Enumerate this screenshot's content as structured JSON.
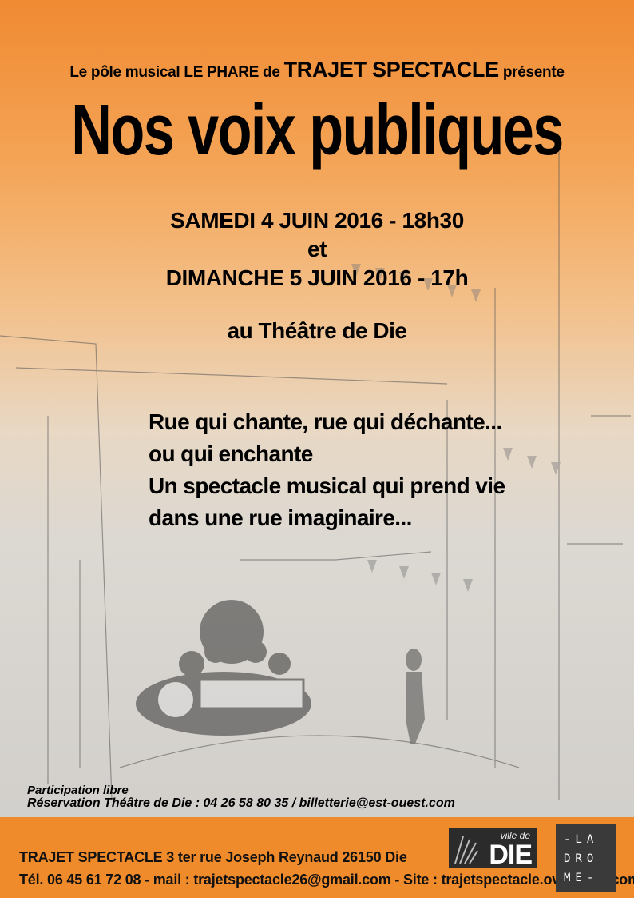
{
  "header": {
    "presents_prefix": "Le pôle musical LE PHARE de",
    "company": "TRAJET SPECTACLE",
    "presents_suffix": "présente"
  },
  "title": "Nos voix publiques",
  "dates": {
    "date1": "SAMEDI 4 JUIN 2016 - 18h30",
    "conjunction": "et",
    "date2": "DIMANCHE 5 JUIN 2016 - 17h"
  },
  "venue": "au Théâtre de Die",
  "description": [
    "Rue qui chante, rue qui déchante...",
    "ou qui enchante",
    "Un spectacle musical qui prend vie",
    "dans une rue imaginaire..."
  ],
  "info": {
    "participation": "Participation libre",
    "reservation": "Réservation Théâtre de Die : 04 26 58 80 35 / billetterie@est-ouest.com"
  },
  "footer": {
    "company_name": "TRAJET SPECTACLE",
    "address": "3 ter rue Joseph Reynaud 26150 Die",
    "contact": "Tél. 06 45 61 72 08 - mail : trajetspectacle26@gmail.com - Site : trajetspectacle.over-blog.com"
  },
  "logos": {
    "ville_de_die": {
      "small": "ville de",
      "big": "DIE"
    },
    "la_drome": {
      "row1": "-LA",
      "row2": "DRO",
      "row3": "ME-"
    }
  },
  "colors": {
    "orange": "#f08a32",
    "footer": "#f08b2c",
    "text": "#000000"
  }
}
